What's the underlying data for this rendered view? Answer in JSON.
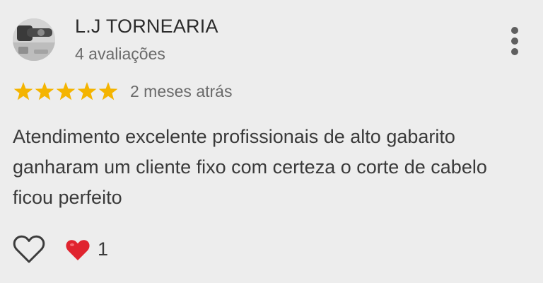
{
  "reviewer": {
    "name": "L.J TORNEARIA",
    "meta": "4 avaliações"
  },
  "review": {
    "rating": 5,
    "rating_max": 5,
    "date": "2 meses atrás",
    "text": "Atendimento excelente profissionais de alto gabarito ganharam um cliente fixo com certeza o corte de cabelo ficou perfeito"
  },
  "reactions": {
    "like_icon": "heart-outline-icon",
    "reaction_icon": "red-heart-icon",
    "count": "1"
  },
  "colors": {
    "star": "#f4b400",
    "heart": "#e0242f",
    "background": "#ededed"
  }
}
